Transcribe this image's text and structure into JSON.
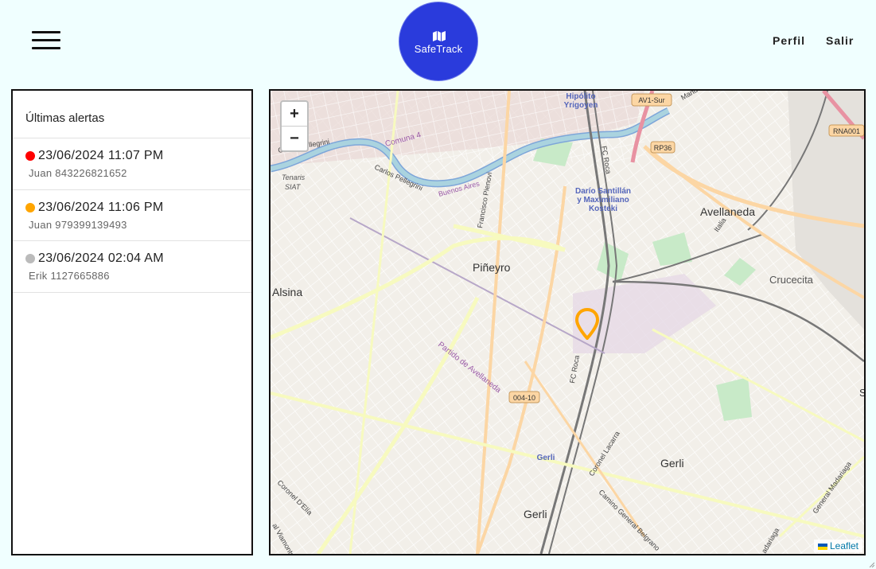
{
  "header": {
    "logo_text": "SafeTrack",
    "nav": {
      "perfil": "Perfil",
      "salir": "Salir"
    }
  },
  "sidebar": {
    "title": "Últimas alertas",
    "alerts": [
      {
        "datetime": "23/06/2024 11:07 PM",
        "detail": "Juan 843226821652",
        "color": "#ff0000"
      },
      {
        "datetime": "23/06/2024 11:06 PM",
        "detail": "Juan 979399139493",
        "color": "#ffa500"
      },
      {
        "datetime": "23/06/2024 02:04 AM",
        "detail": "Erik 1127665886",
        "color": "#bbbbbb"
      }
    ]
  },
  "map": {
    "zoom_in": "+",
    "zoom_out": "−",
    "attribution": "Leaflet",
    "marker_color": "#ffa500",
    "labels": {
      "hipolito": "Hipólito",
      "yrigoyen": "Yrigoyen",
      "av1sur": "AV1-Sur",
      "manuel": "Manuel",
      "rp36": "RP36",
      "rna001": "RNA001",
      "comuna4": "Comuna 4",
      "carlos_pellegrini": "Carlos Pellegrini",
      "carlos_pellegrini_2": "Carlos Pellegrini",
      "tenaris": "Tenaris",
      "siat": "SIAT",
      "buenos_aires": "Buenos Aires",
      "francisco_pienovi": "Francisco Pienovi",
      "fc_roca": "FC Roca",
      "fc_roca_2": "FC Roca",
      "dario1": "Darío Santillán",
      "dario2": "y Maximiliano",
      "dario3": "Kosteki",
      "avellaneda": "Avellaneda",
      "italia": "Italia",
      "crucecita": "Crucecita",
      "pineyro": "Piñeyro",
      "alsina": "Alsina",
      "partido": "Partido de Avellaneda",
      "road_00410": "004-10",
      "gerli": "Gerli",
      "gerli_station": "Gerli",
      "gerli_bottom": "Gerli",
      "coronel_lacarra": "Coronel Lacarra",
      "camino_belgrano": "Camino General Belgrano",
      "coronel_delia": "Coronel D'Elía",
      "viamonte": "al Viamonte",
      "general_madariaga": "General Madariaga",
      "madariaga": "adariaga",
      "s_edge": "S"
    }
  }
}
